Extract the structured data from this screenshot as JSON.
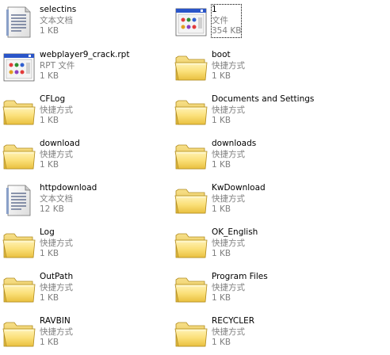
{
  "items": [
    {
      "name": "selectins",
      "type": "文本文档",
      "size": "1 KB",
      "icon": "text-document-icon"
    },
    {
      "name": "1",
      "type": "文件",
      "size": "354 KB",
      "icon": "generic-file-icon",
      "selected": true
    },
    {
      "name": "webplayer9_crack.rpt",
      "type": "RPT 文件",
      "size": "1 KB",
      "icon": "generic-file-icon"
    },
    {
      "name": "boot",
      "type": "快捷方式",
      "size": "1 KB",
      "icon": "folder-shortcut-icon"
    },
    {
      "name": "CFLog",
      "type": "快捷方式",
      "size": "1 KB",
      "icon": "folder-shortcut-icon"
    },
    {
      "name": "Documents and Settings",
      "type": "快捷方式",
      "size": "1 KB",
      "icon": "folder-shortcut-icon"
    },
    {
      "name": "download",
      "type": "快捷方式",
      "size": "1 KB",
      "icon": "folder-shortcut-icon"
    },
    {
      "name": "downloads",
      "type": "快捷方式",
      "size": "1 KB",
      "icon": "folder-shortcut-icon"
    },
    {
      "name": "httpdownload",
      "type": "文本文档",
      "size": "12 KB",
      "icon": "text-document-icon"
    },
    {
      "name": "KwDownload",
      "type": "快捷方式",
      "size": "1 KB",
      "icon": "folder-shortcut-icon"
    },
    {
      "name": "Log",
      "type": "快捷方式",
      "size": "1 KB",
      "icon": "folder-shortcut-icon"
    },
    {
      "name": "OK_English",
      "type": "快捷方式",
      "size": "1 KB",
      "icon": "folder-shortcut-icon"
    },
    {
      "name": "OutPath",
      "type": "快捷方式",
      "size": "1 KB",
      "icon": "folder-shortcut-icon"
    },
    {
      "name": "Program Files",
      "type": "快捷方式",
      "size": "1 KB",
      "icon": "folder-shortcut-icon"
    },
    {
      "name": "RAVBIN",
      "type": "快捷方式",
      "size": "1 KB",
      "icon": "folder-shortcut-icon"
    },
    {
      "name": "RECYCLER",
      "type": "快捷方式",
      "size": "1 KB",
      "icon": "folder-shortcut-icon"
    }
  ]
}
